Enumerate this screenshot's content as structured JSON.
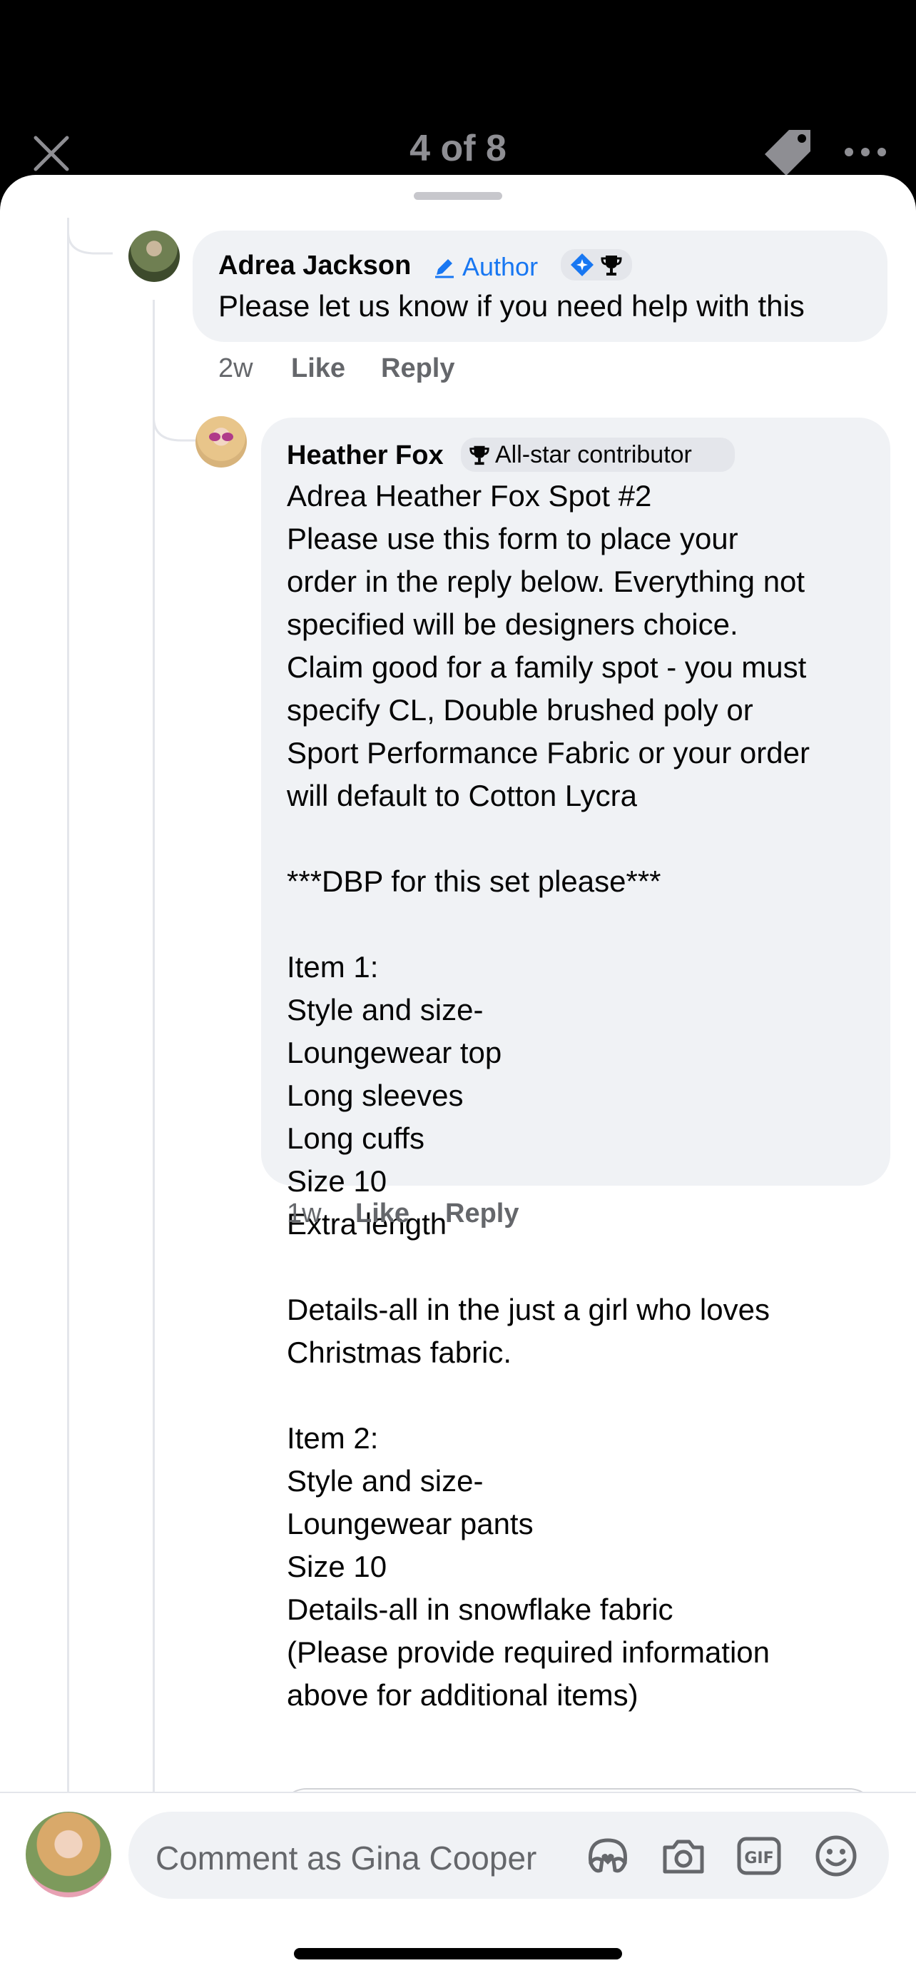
{
  "header": {
    "counter": "4 of 8"
  },
  "comments": [
    {
      "name": "Adrea Jackson",
      "author_label": "Author",
      "text": "Please let us know if you need help with this",
      "time": "2w",
      "like": "Like",
      "reply": "Reply"
    },
    {
      "name": "Heather Fox",
      "badge": "All-star contributor",
      "text": "Adrea Heather Fox Spot #2\nPlease use this form to place your\norder in the reply below. Everything not\nspecified will be designers choice.\nClaim good for a family spot - you must\nspecify CL, Double brushed poly or\nSport Performance Fabric or your order\nwill default to Cotton Lycra\n\n***DBP for this set please***\n\nItem 1:\nStyle and size-\nLoungewear top\nLong sleeves\nLong cuffs\nSize 10\nExtra length\n\nDetails-all in the just a girl who loves\nChristmas fabric.\n\nItem 2:\nStyle and size-\nLoungewear pants\nSize 10\nDetails-all in snowflake fabric\n(Please provide required information\nabove for additional items)",
      "time": "1w",
      "like": "Like",
      "reply": "Reply"
    }
  ],
  "composer": {
    "placeholder": "Comment as Gina Cooper"
  },
  "colors": {
    "accent": "#1877f2",
    "bubble": "#f0f2f5",
    "meta": "#65676b"
  }
}
